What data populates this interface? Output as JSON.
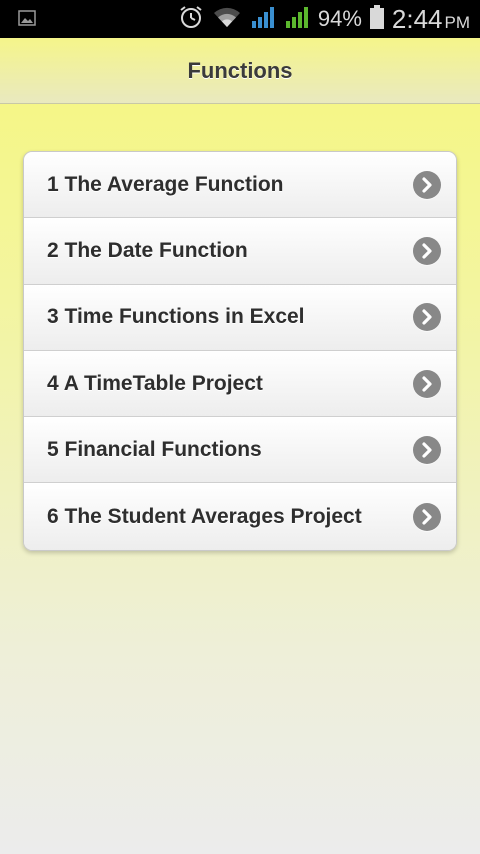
{
  "status_bar": {
    "battery": "94%",
    "time": "2:44",
    "ampm": "PM",
    "icons": [
      "image-icon",
      "alarm-icon",
      "wifi-icon",
      "signal-1-icon",
      "signal-2-icon",
      "battery-icon"
    ]
  },
  "header": {
    "title": "Functions"
  },
  "list": {
    "items": [
      {
        "label": "1 The Average Function"
      },
      {
        "label": "2 The Date Function"
      },
      {
        "label": "3 Time Functions in Excel"
      },
      {
        "label": "4 A TimeTable Project"
      },
      {
        "label": "5 Financial Functions"
      },
      {
        "label": "6 The Student Averages Project"
      }
    ]
  },
  "colors": {
    "header_top": "#f5f58a",
    "background_top": "#f6f77a",
    "chevron_circle": "#888888",
    "signal_1": "#3a8fd0",
    "signal_2": "#5cb82e"
  }
}
